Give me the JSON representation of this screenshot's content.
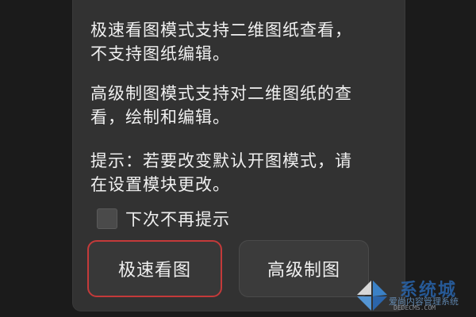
{
  "dialog": {
    "message_fast": "极速看图模式支持二维图纸查看，\n不支持图纸编辑。",
    "message_fast_line1": "极速看图模式支持二维图纸查看，",
    "message_fast_line2": "不支持图纸编辑。",
    "message_advanced_line1": "高级制图模式支持对二维图纸的查",
    "message_advanced_line2": "看，绘制和编辑。",
    "tip_line1": "提示：若要改变默认开图模式，请",
    "tip_line2": "在设置模块更改。",
    "checkbox_label": "下次不再提示",
    "checkbox_checked": false,
    "button_fast": "极速看图",
    "button_advanced": "高级制图"
  },
  "watermark": {
    "title": "系统城",
    "subtitle": "爱尚内容管理系统",
    "url": "DEDECMS.COM"
  },
  "colors": {
    "dialog_bg": "#323232",
    "text": "#f0f0f0",
    "focus_border": "#c43a3a"
  }
}
